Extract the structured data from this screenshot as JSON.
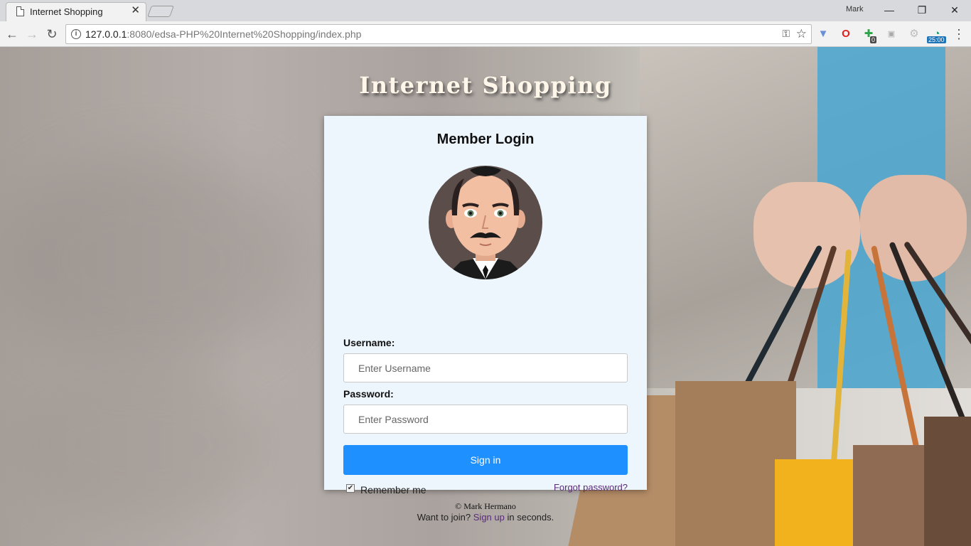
{
  "browser": {
    "tab_title": "Internet Shopping",
    "user_name": "Mark",
    "url_host": "127.0.0.1",
    "url_rest": ":8080/edsa-PHP%20Internet%20Shopping/index.php",
    "ext_badges": {
      "green": "0",
      "timer": "25:00"
    }
  },
  "page": {
    "site_title": "Internet Shopping",
    "login": {
      "title": "Member Login",
      "username_label": "Username:",
      "username_placeholder": "Enter Username",
      "password_label": "Password:",
      "password_placeholder": "Enter Password",
      "signin_label": "Sign in",
      "remember_label": "Remember me",
      "remember_checked": true,
      "forgot_label": "Forgot password?",
      "join_prefix": "Want to join?",
      "signup_label": "Sign up",
      "join_suffix": "in seconds."
    },
    "copyright": "© Mark Hermano"
  },
  "colors": {
    "primary_button": "#1e90ff",
    "link": "#5a2a7a",
    "card_background": "#eef6fd"
  }
}
